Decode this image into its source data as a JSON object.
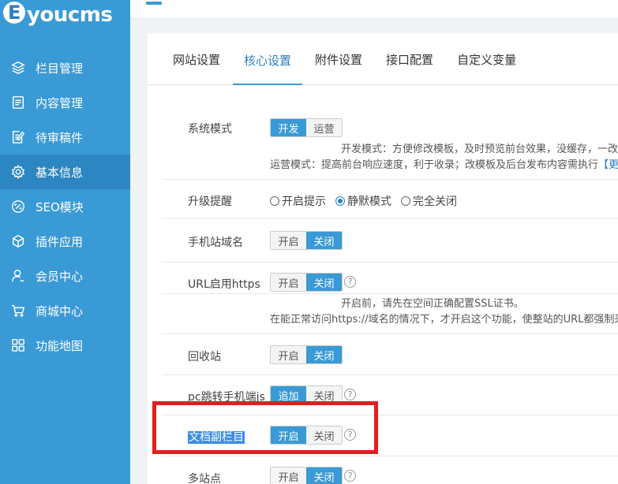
{
  "logo": {
    "letter": "E",
    "text": "youcms"
  },
  "sidebar": {
    "items": [
      {
        "label": "栏目管理",
        "icon": "layers-icon"
      },
      {
        "label": "内容管理",
        "icon": "document-icon"
      },
      {
        "label": "待审稿件",
        "icon": "edit-document-icon"
      },
      {
        "label": "基本信息",
        "icon": "gear-icon",
        "active": true
      },
      {
        "label": "SEO模块",
        "icon": "link-icon"
      },
      {
        "label": "插件应用",
        "icon": "cube-icon"
      },
      {
        "label": "会员中心",
        "icon": "user-icon"
      },
      {
        "label": "商城中心",
        "icon": "cart-icon"
      },
      {
        "label": "功能地图",
        "icon": "grid-icon"
      }
    ]
  },
  "tabs": [
    {
      "label": "网站设置"
    },
    {
      "label": "核心设置",
      "active": true
    },
    {
      "label": "附件设置"
    },
    {
      "label": "接口配置"
    },
    {
      "label": "自定义变量"
    }
  ],
  "settings": {
    "system_mode": {
      "label": "系统模式",
      "options": [
        "开发",
        "运营"
      ],
      "selected": "开发",
      "note1": "开发模式：方便修改模板，及时预览前台效果，没缓存，一改便",
      "note2_prefix": "运营模式：提高前台响应速度，利于收录；改模板及后台发布内容需执行",
      "note2_link": "【更新"
    },
    "upgrade_notice": {
      "label": "升级提醒",
      "options": [
        "开启提示",
        "静默模式",
        "完全关闭"
      ],
      "selected": "静默模式"
    },
    "mobile_domain": {
      "label": "手机站域名",
      "on": "开启",
      "off": "关闭",
      "selected": "关闭"
    },
    "https": {
      "label": "URL启用https",
      "on": "开启",
      "off": "关闭",
      "selected": "关闭",
      "note1": "开启前，请先在空间正确配置SSL证书。",
      "note2": "在能正常访问https://域名的情况下，才开启这个功能，使整站的URL都强制采用"
    },
    "recycle": {
      "label": "回收站",
      "on": "开启",
      "off": "关闭",
      "selected": "关闭"
    },
    "pc_jump": {
      "label": "pc跳转手机端js",
      "on": "追加",
      "off": "关闭",
      "selected": "追加"
    },
    "doc_sub_column": {
      "label": "文档副栏目",
      "on": "开启",
      "off": "关闭",
      "selected": "开启"
    },
    "multi_site": {
      "label": "多站点",
      "on": "开启",
      "off": "关闭",
      "selected": "关闭"
    }
  },
  "help_glyph": "?"
}
